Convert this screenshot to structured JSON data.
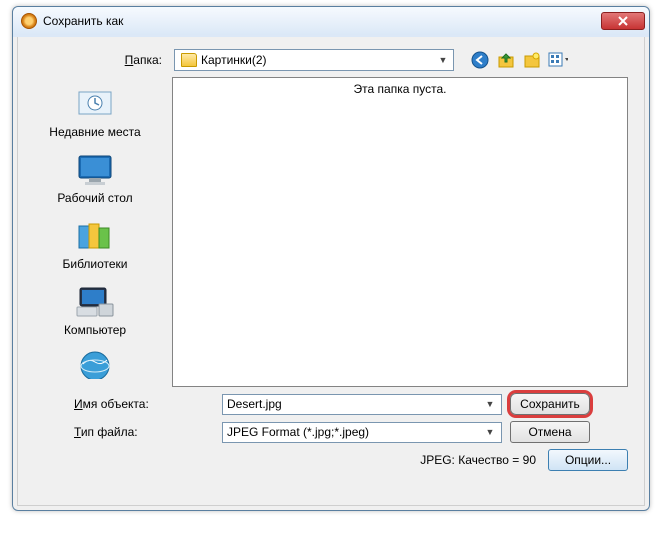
{
  "titlebar": {
    "title": "Сохранить как"
  },
  "toprow": {
    "folder_label_pre": "П",
    "folder_label_post": "апка:",
    "current_folder": "Картинки(2)"
  },
  "nav_icons": {
    "back": "back-icon",
    "up": "up-icon",
    "newfolder": "new-folder-icon",
    "views": "views-icon"
  },
  "places": [
    {
      "label": "Недавние места"
    },
    {
      "label": "Рабочий стол"
    },
    {
      "label": "Библиотеки"
    },
    {
      "label": "Компьютер"
    }
  ],
  "filearea": {
    "empty_text": "Эта папка пуста."
  },
  "bottom": {
    "name_label_pre": "И",
    "name_label_post": "мя объекта:",
    "name_value": "Desert.jpg",
    "type_label_pre": "Т",
    "type_label_post": "ип файла:",
    "type_value": "JPEG Format (*.jpg;*.jpeg)",
    "save_label": "Сохранить",
    "cancel_label": "Отмена",
    "status_text": "JPEG: Качество = 90",
    "options_label": "Опции..."
  }
}
